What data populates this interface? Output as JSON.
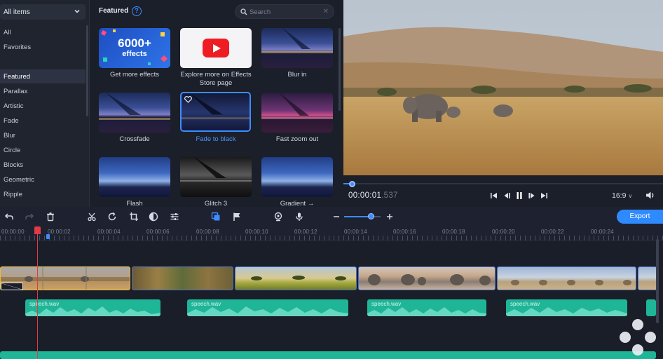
{
  "sidebar": {
    "dropdown_label": "All items",
    "items": [
      "All",
      "Favorites",
      "Featured",
      "Parallax",
      "Artistic",
      "Fade",
      "Blur",
      "Circle",
      "Blocks",
      "Geometric",
      "Ripple"
    ],
    "selected": "Featured"
  },
  "effects": {
    "title": "Featured",
    "search_placeholder": "Search",
    "tiles": [
      {
        "label": "Get more effects",
        "badge_big": "6000+",
        "badge_small": "effects"
      },
      {
        "label": "Explore more on Effects Store page"
      },
      {
        "label": "Blur in"
      },
      {
        "label": "Crossfade"
      },
      {
        "label": "Fade to black",
        "selected": true
      },
      {
        "label": "Fast zoom out"
      },
      {
        "label": "Flash"
      },
      {
        "label": "Glitch 3"
      },
      {
        "label": "Gradient →"
      }
    ]
  },
  "player": {
    "timecode": "00:00:01",
    "timecode_ms": ".537",
    "aspect_ratio": "16:9",
    "progress": 0.03
  },
  "toolbar": {
    "export_label": "Export",
    "zoom_level": 0.72
  },
  "timeline": {
    "ruler_labels": [
      "00:00:00",
      "00:00:02",
      "00:00:04",
      "00:00:06",
      "00:00:08",
      "00:00:10",
      "00:00:12",
      "00:00:14",
      "00:00:16",
      "00:00:18",
      "00:00:20",
      "00:00:22",
      "00:00:24"
    ],
    "audio_clips": [
      "speech.wav",
      "speech.wav",
      "speech.wav",
      "speech.wav"
    ]
  },
  "colors": {
    "accent": "#3f8cff",
    "audio": "#1fb597",
    "playhead": "#e23a45",
    "selected_clip": "#f1b92c"
  }
}
